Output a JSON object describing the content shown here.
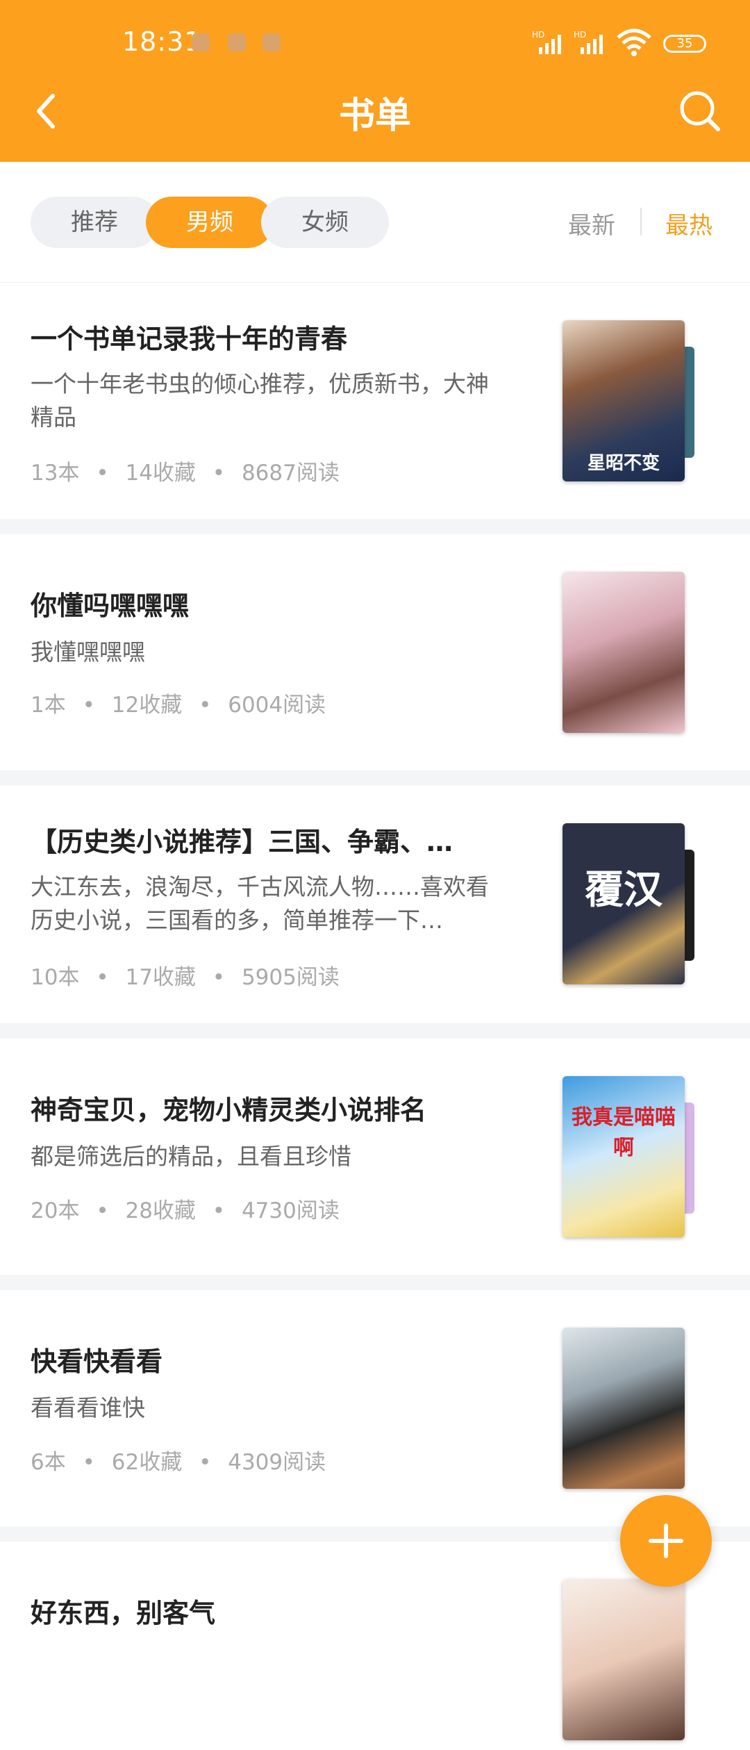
{
  "status_bar": {
    "time": "18:31",
    "battery": "35",
    "net1": "HD",
    "net2": "HD"
  },
  "header": {
    "title": "书单"
  },
  "filters": {
    "tabs": [
      "推荐",
      "男频",
      "女频"
    ],
    "active_tab": "男频"
  },
  "sort": {
    "newest": "最新",
    "hottest": "最热",
    "active": "最热"
  },
  "colors": {
    "accent": "#fca01e",
    "sort_active": "#f0a020"
  },
  "booklists": [
    {
      "title": "一个书单记录我十年的青春",
      "desc": "一个十年老书虫的倾心推荐，优质新书，大神精品",
      "books": "13本",
      "favorites": "14收藏",
      "reads": "8687阅读",
      "cover_text": "星昭不变"
    },
    {
      "title": "你懂吗嘿嘿嘿",
      "desc": "我懂嘿嘿嘿",
      "books": "1本",
      "favorites": "12收藏",
      "reads": "6004阅读",
      "cover_text": ""
    },
    {
      "title": "【历史类小说推荐】三国、争霸、…",
      "desc": "大江东去，浪淘尽，千古风流人物……喜欢看历史小说，三国看的多，简单推荐一下…",
      "books": "10本",
      "favorites": "17收藏",
      "reads": "5905阅读",
      "cover_text": "覆汉"
    },
    {
      "title": "神奇宝贝，宠物小精灵类小说排名",
      "desc": "都是筛选后的精品，且看且珍惜",
      "books": "20本",
      "favorites": "28收藏",
      "reads": "4730阅读",
      "cover_text": "我真是喵喵啊"
    },
    {
      "title": "快看快看看",
      "desc": "看看看谁快",
      "books": "6本",
      "favorites": "62收藏",
      "reads": "4309阅读",
      "cover_text": ""
    },
    {
      "title": "好东西，别客气",
      "desc": "",
      "books": "",
      "favorites": "",
      "reads": "",
      "cover_text": ""
    }
  ],
  "meta_separator": "•"
}
